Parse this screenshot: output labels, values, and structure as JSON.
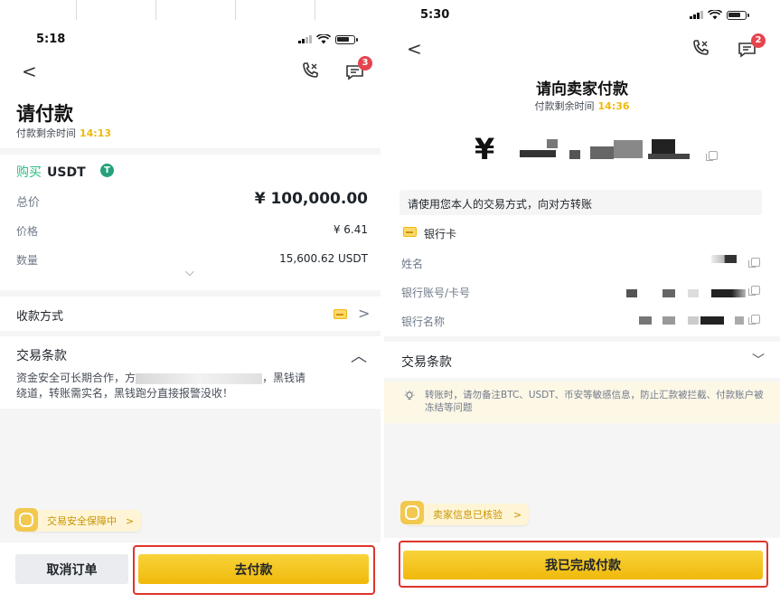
{
  "left": {
    "status_time": "5:18",
    "back_glyph": "<",
    "message_badge": "3",
    "title": "请付款",
    "timer_label": "付款剩余时间",
    "timer_value": "14:13",
    "buy_label": "购买",
    "coin": "USDT",
    "coin_icon": "T",
    "total_label": "总价",
    "total_value": "¥ 100,000.00",
    "price_label": "价格",
    "price_value": "¥ 6.41",
    "qty_label": "数量",
    "qty_value": "15,600.62 USDT",
    "expand_glyph": "⌵",
    "pay_method_label": "收款方式",
    "pay_method_chevron": ">",
    "terms_title": "交易条款",
    "terms_collapse_glyph": "︿",
    "terms_line1_a": "资金安全可长期合作，方",
    "terms_line1_b": "，黑钱请",
    "terms_line2": "绕道，转账需实名，黑钱跑分直接报警没收！",
    "guard_label": "交易安全保障中",
    "guard_chevron": ">",
    "cancel_label": "取消订单",
    "pay_label": "去付款"
  },
  "right": {
    "status_time": "5:30",
    "back_glyph": "<",
    "message_badge": "2",
    "title": "请向卖家付款",
    "timer_label": "付款剩余时间",
    "timer_value": "14:36",
    "amount_prefix": "¥",
    "notice": "请使用您本人的交易方式，向对方转账",
    "bank_card_label": "银行卡",
    "name_label": "姓名",
    "account_label": "银行账号/卡号",
    "bank_name_label": "银行名称",
    "terms_title": "交易条款",
    "terms_expand_glyph": "﹀",
    "warning": "转账时，请勿备注BTC、USDT、币安等敏感信息，防止汇款被拦截、付款账户被冻结等问题",
    "seller_verified": "卖家信息已核验",
    "seller_chevron": ">",
    "done_label": "我已完成付款"
  },
  "colors": {
    "brand_gold": "#f0b90b",
    "buy_green": "#2ebd85",
    "badge_red": "#e5444f",
    "highlight_red": "#e0342b"
  },
  "icons": [
    "back-icon",
    "phone-icon",
    "chat-icon",
    "tether-icon",
    "chevron-down-icon",
    "bank-card-icon",
    "chevron-right-icon",
    "chevron-up-icon",
    "shield-icon",
    "copy-icon",
    "lightbulb-icon",
    "signal-icon",
    "wifi-icon",
    "battery-icon"
  ]
}
